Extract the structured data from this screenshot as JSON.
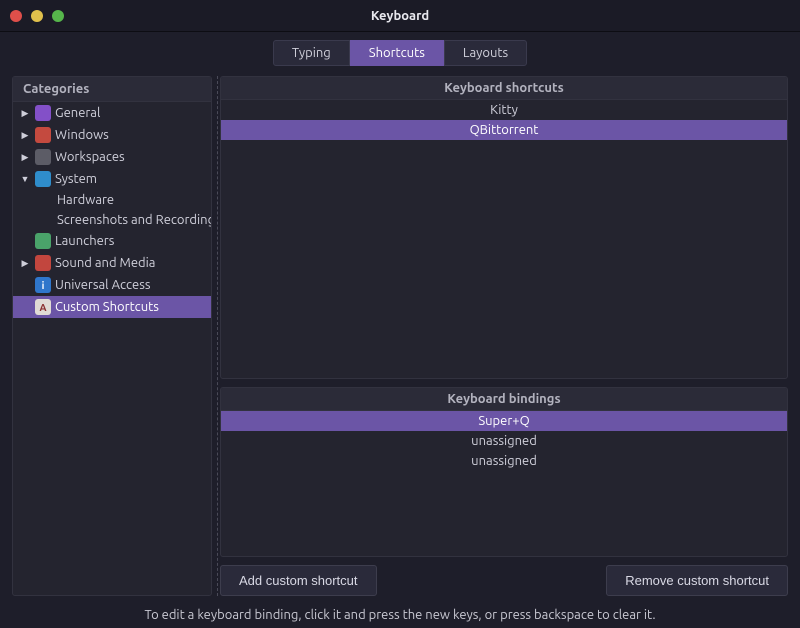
{
  "window": {
    "title": "Keyboard"
  },
  "tabs": [
    {
      "label": "Typing",
      "active": false
    },
    {
      "label": "Shortcuts",
      "active": true
    },
    {
      "label": "Layouts",
      "active": false
    }
  ],
  "sidebar": {
    "header": "Categories",
    "items": [
      {
        "label": "General",
        "expandable": true,
        "expanded": false,
        "icon": "general-icon",
        "iconClass": "ico-general"
      },
      {
        "label": "Windows",
        "expandable": true,
        "expanded": false,
        "icon": "windows-icon",
        "iconClass": "ico-windows"
      },
      {
        "label": "Workspaces",
        "expandable": true,
        "expanded": false,
        "icon": "workspaces-icon",
        "iconClass": "ico-workspaces"
      },
      {
        "label": "System",
        "expandable": true,
        "expanded": true,
        "icon": "system-icon",
        "iconClass": "ico-system",
        "children": [
          {
            "label": "Hardware"
          },
          {
            "label": "Screenshots and Recording"
          }
        ]
      },
      {
        "label": "Launchers",
        "expandable": false,
        "icon": "launchers-icon",
        "iconClass": "ico-launchers"
      },
      {
        "label": "Sound and Media",
        "expandable": true,
        "expanded": false,
        "icon": "sound-icon",
        "iconClass": "ico-sound"
      },
      {
        "label": "Universal Access",
        "expandable": false,
        "icon": "universal-access-icon",
        "iconClass": "ico-universal",
        "iconText": "i"
      },
      {
        "label": "Custom Shortcuts",
        "expandable": false,
        "selected": true,
        "icon": "custom-shortcuts-icon",
        "iconClass": "ico-custom",
        "iconText": "A"
      }
    ]
  },
  "shortcuts": {
    "header": "Keyboard shortcuts",
    "items": [
      {
        "label": "Kitty",
        "selected": false
      },
      {
        "label": "QBittorrent",
        "selected": true
      }
    ]
  },
  "bindings": {
    "header": "Keyboard bindings",
    "items": [
      {
        "label": "Super+Q",
        "selected": true
      },
      {
        "label": "unassigned",
        "selected": false
      },
      {
        "label": "unassigned",
        "selected": false
      }
    ]
  },
  "buttons": {
    "add": "Add custom shortcut",
    "remove": "Remove custom shortcut"
  },
  "hint": "To edit a keyboard binding, click it and press the new keys, or press backspace to clear it."
}
